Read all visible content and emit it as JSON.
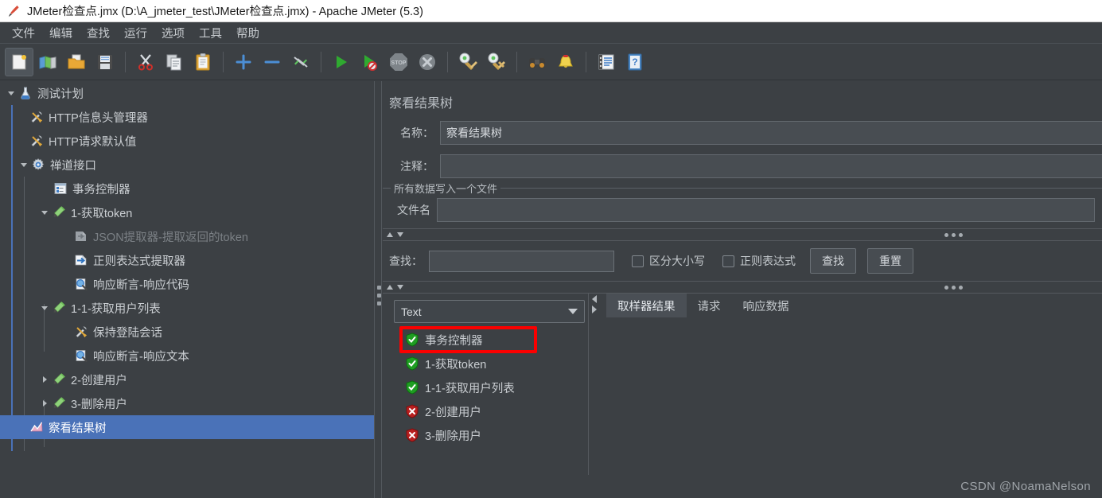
{
  "window": {
    "title": "JMeter检查点.jmx (D:\\A_jmeter_test\\JMeter检查点.jmx) - Apache JMeter (5.3)",
    "logo_icon": "jmeter-feather-icon"
  },
  "menubar": {
    "items": [
      {
        "label": "文件",
        "name": "menu-file"
      },
      {
        "label": "编辑",
        "name": "menu-edit"
      },
      {
        "label": "查找",
        "name": "menu-search"
      },
      {
        "label": "运行",
        "name": "menu-run"
      },
      {
        "label": "选项",
        "name": "menu-options"
      },
      {
        "label": "工具",
        "name": "menu-tools"
      },
      {
        "label": "帮助",
        "name": "menu-help"
      }
    ]
  },
  "toolbar": {
    "buttons": [
      {
        "icon": "new-document-icon",
        "name": "new-test-plan-button"
      },
      {
        "icon": "templates-icon",
        "name": "templates-button"
      },
      {
        "icon": "open-folder-icon",
        "name": "open-button"
      },
      {
        "icon": "save-floppy-icon",
        "name": "save-button"
      },
      {
        "icon": "scissors-cut-icon",
        "name": "cut-button"
      },
      {
        "icon": "copy-pages-icon",
        "name": "copy-button"
      },
      {
        "icon": "clipboard-paste-icon",
        "name": "paste-button"
      },
      {
        "icon": "plus-icon",
        "name": "expand-all-button"
      },
      {
        "icon": "minus-icon",
        "name": "collapse-all-button"
      },
      {
        "icon": "toggle-icon",
        "name": "toggle-button"
      },
      {
        "icon": "play-green-icon",
        "name": "start-button"
      },
      {
        "icon": "play-no-timers-icon",
        "name": "start-no-pauses-button"
      },
      {
        "icon": "stop-sign-icon",
        "name": "stop-button"
      },
      {
        "icon": "shutdown-x-icon",
        "name": "shutdown-button"
      },
      {
        "icon": "clear-broom-icon",
        "name": "clear-button"
      },
      {
        "icon": "clear-all-broom-icon",
        "name": "clear-all-button"
      },
      {
        "icon": "binoculars-icon",
        "name": "search-button"
      },
      {
        "icon": "bell-reset-icon",
        "name": "reset-search-button"
      },
      {
        "icon": "function-helper-icon",
        "name": "function-helper-button"
      },
      {
        "icon": "help-book-icon",
        "name": "help-button"
      }
    ]
  },
  "tree": {
    "nodes": [
      {
        "label": "测试计划",
        "icon": "test-plan-icon",
        "depth": 0,
        "twisty": "open",
        "name": "tree-node-test-plan"
      },
      {
        "label": "HTTP信息头管理器",
        "icon": "config-wrench-icon",
        "depth": 1,
        "twisty": "none",
        "name": "tree-node-http-header-manager"
      },
      {
        "label": "HTTP请求默认值",
        "icon": "config-wrench-icon",
        "depth": 1,
        "twisty": "none",
        "name": "tree-node-http-request-defaults"
      },
      {
        "label": "禅道接口",
        "icon": "thread-group-gear-icon",
        "depth": 1,
        "twisty": "open",
        "name": "tree-node-thread-group"
      },
      {
        "label": "事务控制器",
        "icon": "transaction-controller-icon",
        "depth": 2,
        "twisty": "none",
        "name": "tree-node-transaction-controller"
      },
      {
        "label": "1-获取token",
        "icon": "http-sampler-icon",
        "depth": 2,
        "twisty": "open",
        "name": "tree-node-sampler-get-token"
      },
      {
        "label": "JSON提取器-提取返回的token",
        "icon": "json-extractor-disabled-icon",
        "depth": 3,
        "twisty": "none",
        "disabled": true,
        "name": "tree-node-json-extractor"
      },
      {
        "label": "正则表达式提取器",
        "icon": "regex-extractor-icon",
        "depth": 3,
        "twisty": "none",
        "name": "tree-node-regex-extractor"
      },
      {
        "label": "响应断言-响应代码",
        "icon": "assertion-magnifier-icon",
        "depth": 3,
        "twisty": "none",
        "name": "tree-node-response-assertion-code"
      },
      {
        "label": "1-1-获取用户列表",
        "icon": "http-sampler-icon",
        "depth": 2,
        "twisty": "open",
        "name": "tree-node-sampler-get-user-list"
      },
      {
        "label": "保持登陆会话",
        "icon": "config-wrench-icon",
        "depth": 3,
        "twisty": "none",
        "name": "tree-node-keep-session"
      },
      {
        "label": "响应断言-响应文本",
        "icon": "assertion-magnifier-icon",
        "depth": 3,
        "twisty": "none",
        "name": "tree-node-response-assertion-text"
      },
      {
        "label": "2-创建用户",
        "icon": "http-sampler-icon",
        "depth": 2,
        "twisty": "closed",
        "name": "tree-node-sampler-create-user"
      },
      {
        "label": "3-删除用户",
        "icon": "http-sampler-icon",
        "depth": 2,
        "twisty": "closed",
        "name": "tree-node-sampler-delete-user"
      },
      {
        "label": "察看结果树",
        "icon": "view-results-tree-icon",
        "depth": 1,
        "twisty": "none",
        "selected": true,
        "name": "tree-node-view-results-tree"
      }
    ]
  },
  "panel": {
    "title": "察看结果树",
    "name_label": "名称：",
    "name_value": "察看结果树",
    "comment_label": "注释：",
    "comment_value": "",
    "group_legend": "所有数据写入一个文件",
    "filename_label": "文件名",
    "filename_value": ""
  },
  "search": {
    "label": "查找：",
    "value": "",
    "case_sensitive_label": "区分大小写",
    "case_sensitive_checked": false,
    "regex_label": "正则表达式",
    "regex_checked": false,
    "search_button": "查找",
    "reset_button": "重置"
  },
  "results": {
    "renderer_selected": "Text",
    "items": [
      {
        "label": "事务控制器",
        "status": "success",
        "highlighted": true,
        "name": "result-item-transaction-controller"
      },
      {
        "label": "1-获取token",
        "status": "success",
        "highlighted": false,
        "name": "result-item-get-token"
      },
      {
        "label": "1-1-获取用户列表",
        "status": "success",
        "highlighted": false,
        "name": "result-item-get-user-list"
      },
      {
        "label": "2-创建用户",
        "status": "failure",
        "highlighted": false,
        "name": "result-item-create-user"
      },
      {
        "label": "3-删除用户",
        "status": "failure",
        "highlighted": false,
        "name": "result-item-delete-user"
      }
    ],
    "tabs": [
      {
        "label": "取样器结果",
        "active": true,
        "name": "tab-sampler-result"
      },
      {
        "label": "请求",
        "active": false,
        "name": "tab-request"
      },
      {
        "label": "响应数据",
        "active": false,
        "name": "tab-response-data"
      }
    ]
  },
  "watermark": "CSDN @NoamaNelson",
  "colors": {
    "background": "#3c4044",
    "selection": "#4a72b8",
    "annotation_red": "#fb0000",
    "success_green": "#22a024",
    "failure_red": "#c02020",
    "titlebar": "#ffffff"
  }
}
